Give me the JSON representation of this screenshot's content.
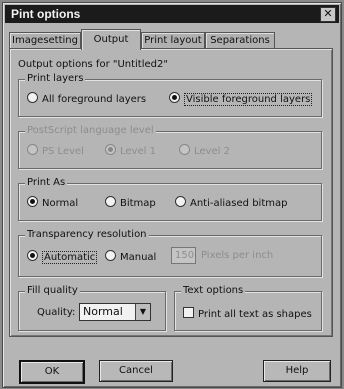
{
  "window": {
    "title": "Pint options",
    "close_glyph": "✕"
  },
  "tabs": [
    {
      "label": "Imagesetting"
    },
    {
      "label": "Output",
      "active": true
    },
    {
      "label": "Print layout"
    },
    {
      "label": "Separations"
    }
  ],
  "output_heading": "Output options for \"Untitled2\"",
  "print_layers": {
    "legend": "Print layers",
    "options": [
      "All foreground layers",
      "Visible foreground layers"
    ],
    "selected": "Visible foreground layers"
  },
  "postscript_level": {
    "legend": "PostScript language level",
    "options": [
      "PS Level",
      "Level 1",
      "Level 2"
    ],
    "selected": "Level 1",
    "disabled": true
  },
  "print_as": {
    "legend": "Print As",
    "options": [
      "Normal",
      "Bitmap",
      "Anti-aliased bitmap"
    ],
    "selected": "Normal"
  },
  "transparency": {
    "legend": "Transparency resolution",
    "options": [
      "Automatic",
      "Manual"
    ],
    "selected": "Automatic",
    "resolution_value": "150",
    "resolution_unit": "Pixels per inch"
  },
  "fill_quality": {
    "legend": "Fill quality",
    "label": "Quality:",
    "value": "Normal"
  },
  "text_options": {
    "legend": "Text options",
    "checkbox_label": "Print all text as shapes",
    "checked": false
  },
  "buttons": {
    "ok": "OK",
    "cancel": "Cancel",
    "help": "Help"
  }
}
